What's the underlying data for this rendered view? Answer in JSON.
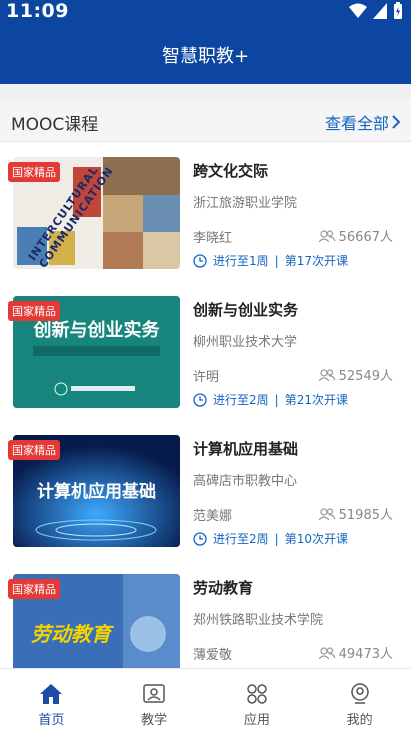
{
  "status": {
    "time": "11:09"
  },
  "header": {
    "title": "智慧职教+"
  },
  "section": {
    "title": "MOOC课程",
    "view_all": "查看全部"
  },
  "courses": [
    {
      "badge": "国家精品",
      "title": "跨文化交际",
      "school": "浙江旅游职业学院",
      "teacher": "李晓红",
      "count": "56667人",
      "progress": "进行至1周",
      "session": "第17次开课",
      "thumb_text": "INTERCULTURAL COMMUNICATION"
    },
    {
      "badge": "国家精品",
      "title": "创新与创业实务",
      "school": "柳州职业技术大学",
      "teacher": "许明",
      "count": "52549人",
      "progress": "进行至2周",
      "session": "第21次开课",
      "thumb_text": "创新与创业实务"
    },
    {
      "badge": "国家精品",
      "title": "计算机应用基础",
      "school": "高碑店市职教中心",
      "teacher": "范美娜",
      "count": "51985人",
      "progress": "进行至2周",
      "session": "第10次开课",
      "thumb_text": "计算机应用基础"
    },
    {
      "badge": "国家精品",
      "title": "劳动教育",
      "school": "郑州铁路职业技术学院",
      "teacher": "薄爱敬",
      "count": "49473人",
      "progress": "",
      "session": "",
      "thumb_text": "劳动教育"
    }
  ],
  "tabs": [
    {
      "label": "首页",
      "icon": "home-icon"
    },
    {
      "label": "教学",
      "icon": "teach-icon"
    },
    {
      "label": "应用",
      "icon": "apps-icon"
    },
    {
      "label": "我的",
      "icon": "profile-icon"
    }
  ],
  "colors": {
    "primary": "#0c46a0",
    "accent": "#1565c0",
    "badge": "#e53935"
  }
}
